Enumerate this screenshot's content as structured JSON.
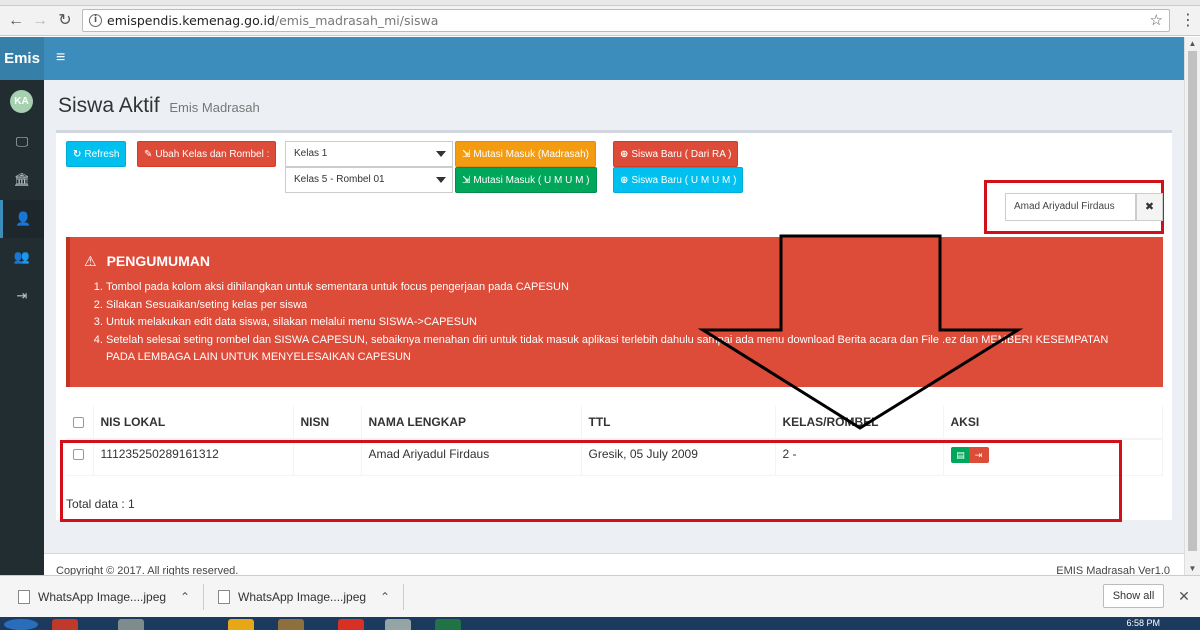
{
  "browser": {
    "url_host": "emispendis.kemenag.go.id",
    "url_path": "/emis_madrasah_mi/siswa"
  },
  "sidebar": {
    "brand": "Emis",
    "avatar_initials": "KA"
  },
  "page": {
    "title": "Siswa Aktif",
    "subtitle": "Emis Madrasah"
  },
  "toolbar": {
    "refresh": "Refresh",
    "ubah_kelas": "Ubah Kelas dan Rombel :",
    "kelas_selected": "Kelas 1",
    "rombel_selected": "Kelas 5 - Rombel 01",
    "mutasi_madrasah": "Mutasi Masuk (Madrasah)",
    "mutasi_umum": "Mutasi Masuk ( U M U M )",
    "siswa_baru_ra": "Siswa Baru ( Dari RA )",
    "siswa_baru_umum": "Siswa Baru ( U M U M )"
  },
  "search": {
    "value": "Amad Ariyadul Firdaus"
  },
  "announcement": {
    "title": "PENGUMUMAN",
    "items": [
      "Tombol pada kolom aksi dihilangkan untuk sementara untuk focus pengerjaan pada CAPESUN",
      "Silakan Sesuaikan/seting kelas per siswa",
      "Untuk melakukan edit data siswa, silakan melalui menu SISWA->CAPESUN",
      "Setelah selesai seting rombel dan SISWA CAPESUN, sebaiknya menahan diri untuk tidak masuk aplikasi terlebih dahulu sampai ada menu download Berita acara dan File .ez dan MEMBERI KESEMPATAN PADA LEMBAGA LAIN UNTUK MENYELESAIKAN CAPESUN"
    ]
  },
  "table": {
    "headers": [
      "NIS LOKAL",
      "NISN",
      "NAMA LENGKAP",
      "TTL",
      "KELAS/ROMBEL",
      "AKSI"
    ],
    "rows": [
      {
        "nis_lokal": "111235250289161312",
        "nisn": "",
        "nama": "Amad Ariyadul Firdaus",
        "ttl": "Gresik, 05 July 2009",
        "kelas": "2 -"
      }
    ],
    "total": "Total data : 1"
  },
  "footer": {
    "copyright": "Copyright © 2017. All rights reserved.",
    "version": "EMIS Madrasah Ver1.0"
  },
  "downloads": {
    "items": [
      "WhatsApp Image....jpeg",
      "WhatsApp Image....jpeg"
    ],
    "show_all": "Show all"
  },
  "taskbar": {
    "clock": "6:58 PM"
  },
  "colors": {
    "primary": "#3c8dbc",
    "danger": "#dd4b39",
    "success": "#00a65a",
    "warning": "#f39c12",
    "info": "#00c0ef",
    "highlight": "#d2101a"
  }
}
